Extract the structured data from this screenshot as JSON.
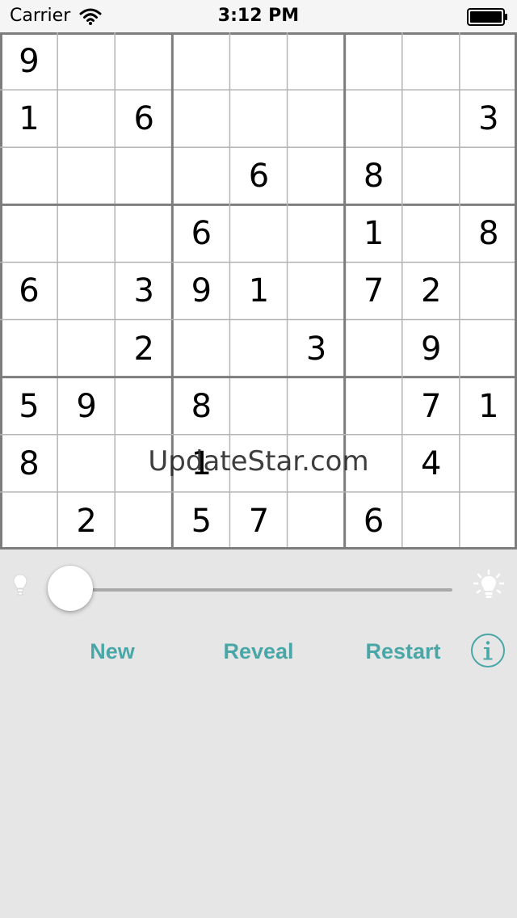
{
  "status_bar": {
    "carrier": "Carrier",
    "time": "3:12 PM"
  },
  "board": {
    "grid": [
      [
        "9",
        "",
        "",
        "",
        "",
        "",
        "",
        "",
        ""
      ],
      [
        "1",
        "",
        "6",
        "",
        "",
        "",
        "",
        "",
        "3"
      ],
      [
        "",
        "",
        "",
        "",
        "6",
        "",
        "8",
        "",
        ""
      ],
      [
        "",
        "",
        "",
        "6",
        "",
        "",
        "1",
        "",
        "8"
      ],
      [
        "6",
        "",
        "3",
        "9",
        "1",
        "",
        "7",
        "2",
        ""
      ],
      [
        "",
        "",
        "2",
        "",
        "",
        "3",
        "",
        "9",
        ""
      ],
      [
        "5",
        "9",
        "",
        "8",
        "",
        "",
        "",
        "7",
        "1"
      ],
      [
        "8",
        "",
        "",
        "1",
        "",
        "",
        "",
        "4",
        ""
      ],
      [
        "",
        "2",
        "",
        "5",
        "7",
        "",
        "6",
        "",
        ""
      ]
    ],
    "watermark": "UpdateStar.com"
  },
  "controls": {
    "hint_slider_value": 0,
    "buttons": {
      "new_label": "New",
      "reveal_label": "Reveal",
      "restart_label": "Restart"
    }
  },
  "icons": {
    "wifi": "wifi-icon",
    "battery": "battery-icon",
    "hint_low": "bulb-dim-icon",
    "hint_high": "bulb-bright-icon",
    "info": "info-icon"
  },
  "colors": {
    "accent": "#4aa7a7",
    "grid_thin": "#b4b4b4",
    "grid_thick": "#7d7d7d",
    "background": "#e6e6e6"
  }
}
